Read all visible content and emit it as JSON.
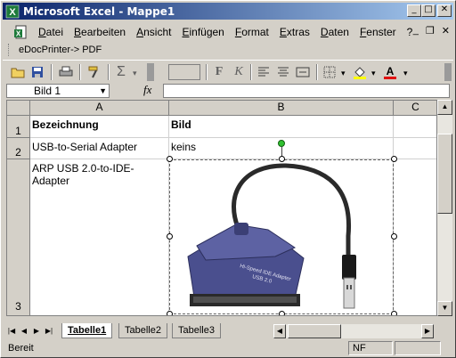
{
  "window": {
    "title": "Microsoft Excel - Mappe1"
  },
  "menu": {
    "items": [
      "Datei",
      "Bearbeiten",
      "Ansicht",
      "Einfügen",
      "Format",
      "Extras",
      "Daten",
      "Fenster",
      "?"
    ]
  },
  "pdfbar": {
    "label": "eDocPrinter-> PDF"
  },
  "formula": {
    "namebox": "Bild 1",
    "fx": "fx",
    "value": ""
  },
  "grid": {
    "columns": [
      "A",
      "B",
      "C"
    ],
    "rows": [
      "1",
      "2",
      "3"
    ],
    "cells": {
      "A1": "Bezeichnung",
      "B1": "Bild",
      "A2": "USB-to-Serial Adapter",
      "B2": "keins",
      "A3": "ARP USB 2.0-to-IDE-Adapter"
    }
  },
  "picture": {
    "name": "Bild 1",
    "device_label": "Hi-Speed IDE Adapter",
    "device_sublabel": "USB 2.0"
  },
  "sheets": {
    "tabs": [
      "Tabelle1",
      "Tabelle2",
      "Tabelle3"
    ],
    "active": "Tabelle1"
  },
  "status": {
    "text": "Bereit",
    "mode": "NF"
  },
  "colors": {
    "title_start": "#0a246a",
    "title_end": "#a6caf0",
    "face": "#d4d0c8",
    "device_blue": "#4a4f8e"
  }
}
